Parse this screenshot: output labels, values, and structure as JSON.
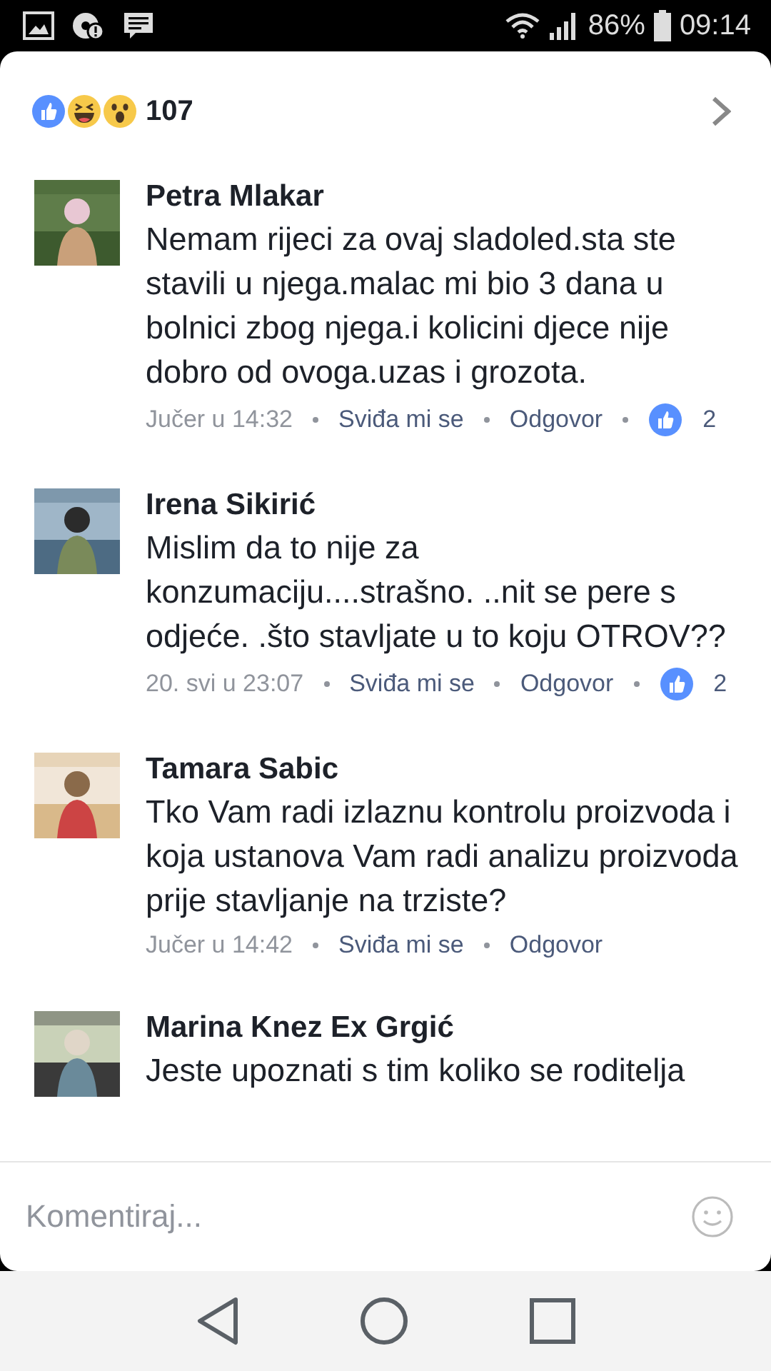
{
  "status_bar": {
    "battery": "86%",
    "time": "09:14"
  },
  "reactions": {
    "count": "107"
  },
  "comments": [
    {
      "name": "Petra Mlakar",
      "text": "Nemam rijeci za ovaj sladoled.sta ste stavili u njega.malac mi bio 3 dana u bolnici zbog njega.i kolicini djece nije dobro od ovoga.uzas i grozota.",
      "time": "Jučer u 14:32",
      "like_label": "Sviđa mi se",
      "reply_label": "Odgovor",
      "like_count": "2"
    },
    {
      "name": "Irena Sikirić",
      "text": "Mislim da to nije za konzumaciju....strašno. ..nit se pere s odjeće. .što stavljate u to koju OTROV??",
      "time": "20. svi u 23:07",
      "like_label": "Sviđa mi se",
      "reply_label": "Odgovor",
      "like_count": "2"
    },
    {
      "name": "Tamara Sabic",
      "text": "Tko Vam radi izlaznu kontrolu proizvoda i koja ustanova Vam radi analizu proizvoda prije stavljanje na trziste?",
      "time": "Jučer u 14:42",
      "like_label": "Sviđa mi se",
      "reply_label": "Odgovor"
    },
    {
      "name": "Marina Knez Ex Grgić",
      "text": "Jeste upoznati s tim koliko se roditelja"
    }
  ],
  "composer": {
    "placeholder": "Komentiraj..."
  }
}
